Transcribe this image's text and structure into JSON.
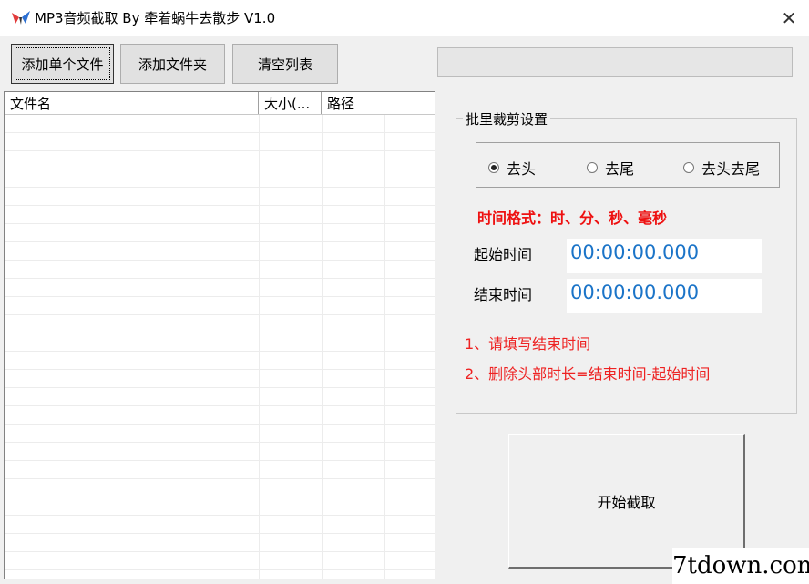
{
  "window": {
    "title": "MP3音频截取 By 牵着蜗牛去散步 V1.0",
    "app_icon": "bird-logo-icon",
    "close_glyph": "✕"
  },
  "toolbar": {
    "add_file": "添加单个文件",
    "add_folder": "添加文件夹",
    "clear_list": "清空列表"
  },
  "progress": {
    "value": 0
  },
  "file_list": {
    "columns": [
      "文件名",
      "大小(...",
      "路径"
    ],
    "rows": []
  },
  "batch": {
    "title": "批里裁剪设置",
    "modes": [
      {
        "label": "去头",
        "checked": true
      },
      {
        "label": "去尾",
        "checked": false
      },
      {
        "label": "去头去尾",
        "checked": false
      }
    ],
    "format_hint": "时间格式：时、分、秒、毫秒",
    "start_label": "起始时间",
    "start_value": "00:00:00.000",
    "end_label": "结束时间",
    "end_value": "00:00:00.000",
    "note1": "1、请填写结束时间",
    "note2": "2、删除头部时长=结束时间-起始时间"
  },
  "actions": {
    "start": "开始截取"
  },
  "watermark": "7tdown.com",
  "colors": {
    "accent_red": "#ee1111",
    "time_blue": "#1b74c8"
  }
}
